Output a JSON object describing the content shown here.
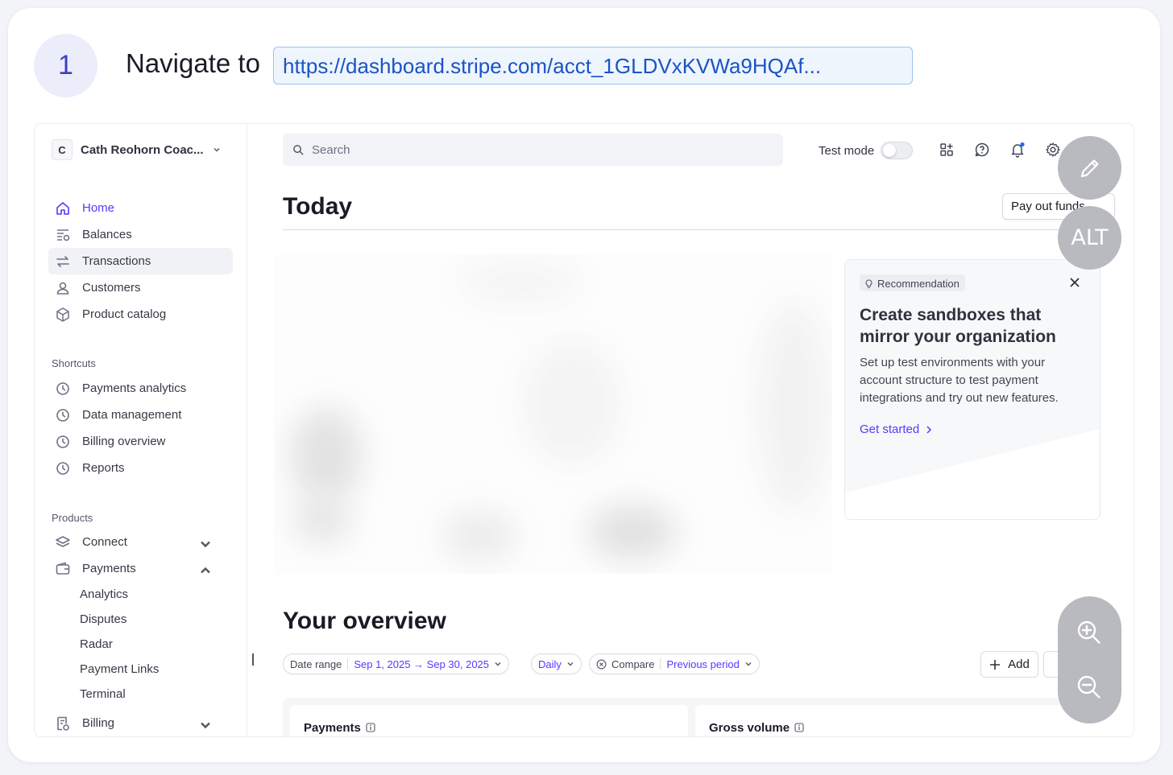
{
  "step": {
    "number": "1",
    "instruction": "Navigate to",
    "url": "https://dashboard.stripe.com/acct_1GLDVxKVWa9HQAf..."
  },
  "account": {
    "initial": "C",
    "name": "Cath Reohorn Coac..."
  },
  "nav": [
    {
      "label": "Home",
      "icon": "home-icon",
      "active": true
    },
    {
      "label": "Balances",
      "icon": "balances-icon"
    },
    {
      "label": "Transactions",
      "icon": "transactions-icon",
      "selected": true
    },
    {
      "label": "Customers",
      "icon": "customer-icon"
    },
    {
      "label": "Product catalog",
      "icon": "box-icon"
    }
  ],
  "shortcuts": {
    "title": "Shortcuts",
    "items": [
      "Payments analytics",
      "Data management",
      "Billing overview",
      "Reports"
    ]
  },
  "products": {
    "title": "Products",
    "items": [
      {
        "label": "Connect",
        "icon": "connect-icon",
        "expanded": false
      },
      {
        "label": "Payments",
        "icon": "wallet-icon",
        "expanded": true
      },
      {
        "label": "Billing",
        "icon": "billing-icon",
        "expanded": false
      }
    ],
    "payments_sub": [
      "Analytics",
      "Disputes",
      "Radar",
      "Payment Links",
      "Terminal"
    ]
  },
  "topbar": {
    "search_placeholder": "Search",
    "test_mode_label": "Test mode",
    "test_mode_on": false,
    "icons": [
      "apps-icon",
      "help-icon",
      "bell-icon",
      "gear-icon"
    ]
  },
  "today": {
    "title": "Today",
    "payout_label": "Pay out funds"
  },
  "recommendation": {
    "badge": "Recommendation",
    "title": "Create sandboxes that mirror your organization",
    "body": "Set up test environments with your account structure to test payment integrations and try out new features.",
    "link": "Get started"
  },
  "overview": {
    "title": "Your overview",
    "date_range_label": "Date range",
    "date_range_value": "Sep 1, 2025 → Sep 30, 2025",
    "interval": "Daily",
    "compare_label": "Compare",
    "compare_value": "Previous period",
    "add_label": "Add",
    "tiles": [
      "Payments",
      "Gross volume"
    ]
  },
  "floating": {
    "edit_icon": "pencil-icon",
    "alt_label": "ALT",
    "zoom_in_icon": "zoom-in-icon",
    "zoom_out_icon": "zoom-out-icon"
  },
  "colors": {
    "accent": "#533afd",
    "link_blue": "#1c53c4",
    "step_bg": "#ecedfb"
  }
}
